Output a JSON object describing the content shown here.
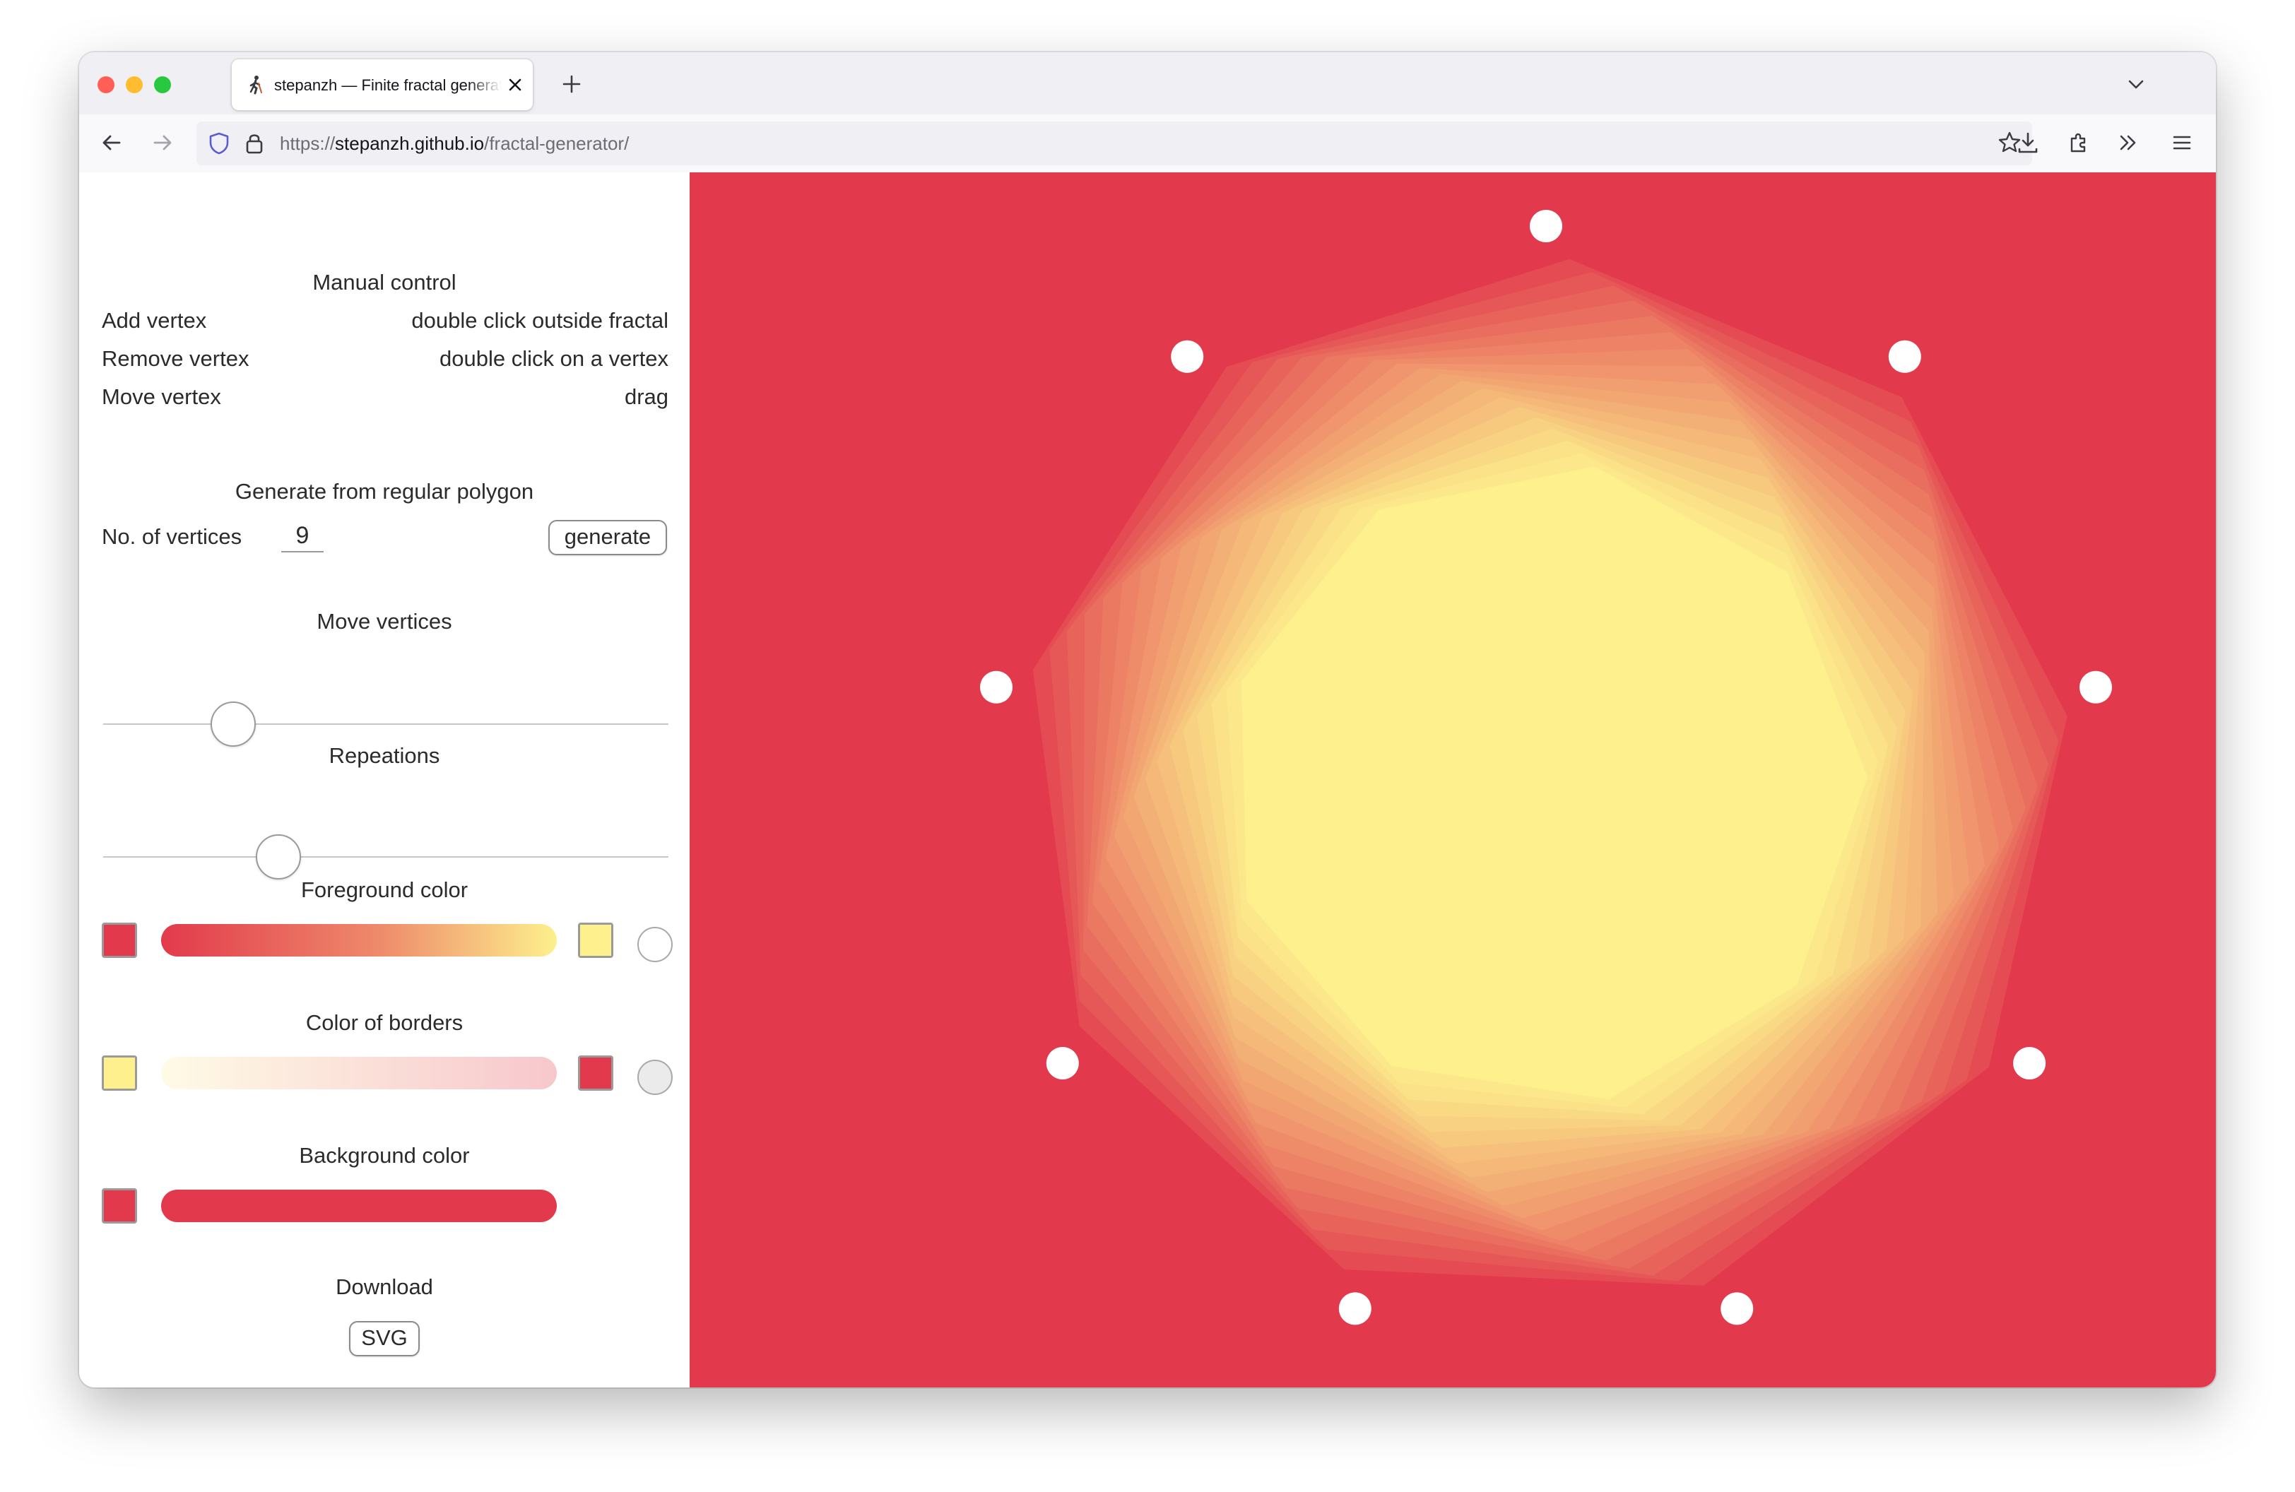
{
  "browser": {
    "tab_title": "stepanzh — Finite fractal generator",
    "url_scheme": "https://",
    "url_host": "stepanzh.github.io",
    "url_path": "/fractal-generator/"
  },
  "manual_control": {
    "title": "Manual control",
    "rows": [
      {
        "action": "Add vertex",
        "how": "double click outside fractal"
      },
      {
        "action": "Remove vertex",
        "how": "double click on a vertex"
      },
      {
        "action": "Move vertex",
        "how": "drag"
      }
    ]
  },
  "generate": {
    "title": "Generate from regular polygon",
    "vertices_label": "No. of vertices",
    "vertices_value": "9",
    "button": "generate"
  },
  "move_vertices": {
    "title": "Move vertices",
    "value": 0.23
  },
  "repetitions": {
    "title": "Repeations",
    "value": 0.31
  },
  "foreground": {
    "title": "Foreground color",
    "from": "#e23a4c",
    "to": "#fdf08d",
    "mid": "#ee8a6b"
  },
  "borders": {
    "title": "Color of borders",
    "from": "#fdf08d",
    "to": "#e23a4c"
  },
  "background": {
    "title": "Background color",
    "color": "#e23a4c"
  },
  "download": {
    "title": "Download",
    "button": "SVG"
  },
  "fractal": {
    "vertex_count": 9,
    "layers": 20,
    "background": "#e23a4c",
    "inner_color": "#fdf08d"
  }
}
